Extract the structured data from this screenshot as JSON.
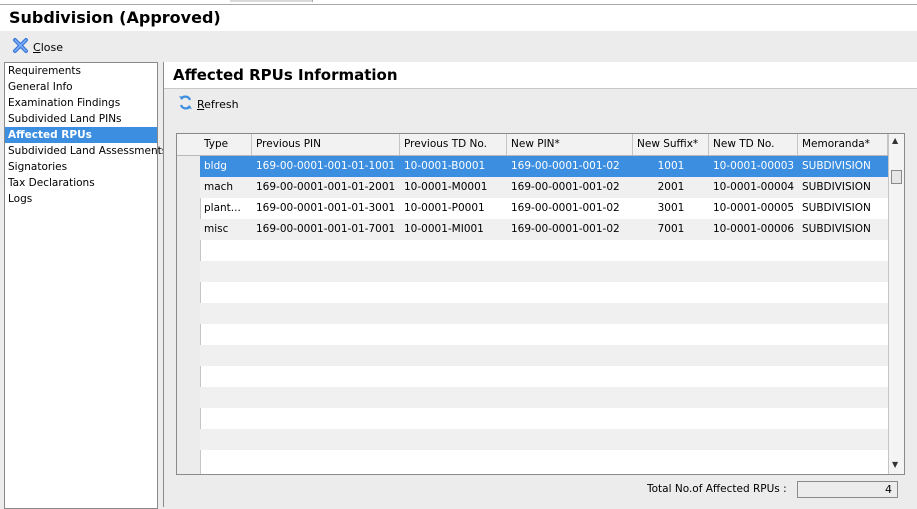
{
  "window": {
    "title": "Subdivision (Approved)"
  },
  "toolbar": {
    "close_label": "Close"
  },
  "sidebar": {
    "items": [
      {
        "label": "Requirements"
      },
      {
        "label": "General Info"
      },
      {
        "label": "Examination Findings"
      },
      {
        "label": "Subdivided Land PINs"
      },
      {
        "label": "Affected RPUs",
        "selected": true
      },
      {
        "label": "Subdivided Land Assessments"
      },
      {
        "label": "Signatories"
      },
      {
        "label": "Tax Declarations"
      },
      {
        "label": "Logs"
      }
    ]
  },
  "main": {
    "title": "Affected RPUs Information",
    "refresh_label": "Refresh",
    "columns": [
      "Type",
      "Previous PIN",
      "Previous TD No.",
      "New PIN*",
      "New Suffix*",
      "New TD No.",
      "Memoranda*"
    ],
    "rows": [
      [
        "bldg",
        "169-00-0001-001-01-1001",
        "10-0001-B0001",
        "169-00-0001-001-02",
        "1001",
        "10-0001-00003",
        "SUBDIVISION"
      ],
      [
        "mach",
        "169-00-0001-001-01-2001",
        "10-0001-M0001",
        "169-00-0001-001-02",
        "2001",
        "10-0001-00004",
        "SUBDIVISION"
      ],
      [
        "plant...",
        "169-00-0001-001-01-3001",
        "10-0001-P0001",
        "169-00-0001-001-02",
        "3001",
        "10-0001-00005",
        "SUBDIVISION"
      ],
      [
        "misc",
        "169-00-0001-001-01-7001",
        "10-0001-MI001",
        "169-00-0001-001-02",
        "7001",
        "10-0001-00006",
        "SUBDIVISION"
      ]
    ],
    "total_label": "Total No.of Affected RPUs :",
    "total_value": "4"
  },
  "colors": {
    "selection": "#3c8ee0",
    "close_icon": "#3c78d8",
    "refresh_icon": "#3c8ee0"
  }
}
